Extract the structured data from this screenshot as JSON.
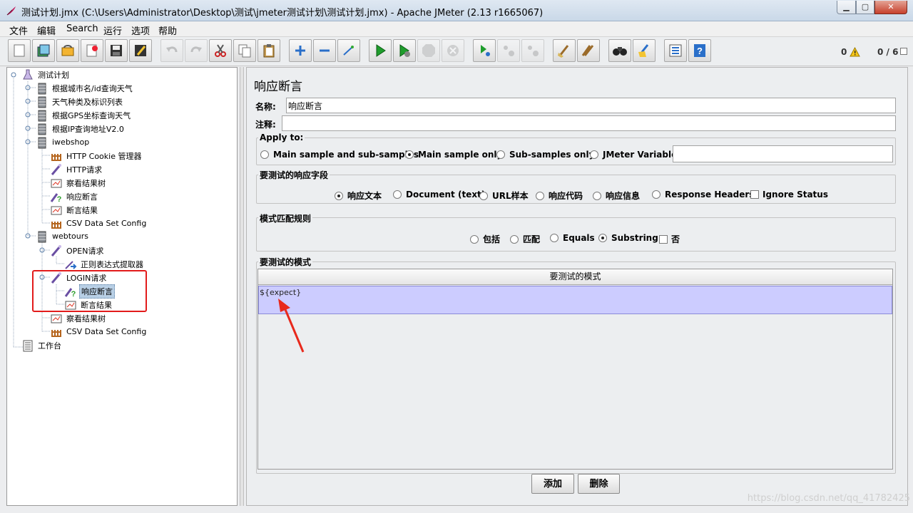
{
  "window": {
    "title": "测试计划.jmx (C:\\Users\\Administrator\\Desktop\\测试\\jmeter测试计划\\测试计划.jmx) - Apache JMeter (2.13 r1665067)",
    "min_glyph": "▁",
    "max_glyph": "▢",
    "close_glyph": "✕"
  },
  "menu": {
    "items": [
      "文件",
      "编辑",
      "Search",
      "运行",
      "选项",
      "帮助"
    ]
  },
  "toolbar": {
    "error_count": "0",
    "thread_status": "0 / 6"
  },
  "tree": {
    "nodes": [
      {
        "label": "测试计划",
        "icon": "test-plan-icon"
      },
      {
        "label": "根据城市名/id查询天气",
        "icon": "thread-group-icon"
      },
      {
        "label": "天气种类及标识列表",
        "icon": "thread-group-icon"
      },
      {
        "label": "根据GPS坐标查询天气",
        "icon": "thread-group-icon"
      },
      {
        "label": "根据IP查询地址V2.0",
        "icon": "thread-group-icon"
      },
      {
        "label": "iwebshop",
        "icon": "thread-group-icon"
      },
      {
        "label": "HTTP Cookie 管理器",
        "icon": "config-icon"
      },
      {
        "label": "HTTP请求",
        "icon": "sampler-icon"
      },
      {
        "label": "察看结果树",
        "icon": "listener-icon"
      },
      {
        "label": "响应断言",
        "icon": "assertion-icon"
      },
      {
        "label": "断言结果",
        "icon": "listener-icon"
      },
      {
        "label": "CSV Data Set Config",
        "icon": "config-icon"
      },
      {
        "label": "webtours",
        "icon": "thread-group-icon"
      },
      {
        "label": "OPEN请求",
        "icon": "sampler-icon"
      },
      {
        "label": "正则表达式提取器",
        "icon": "extractor-icon"
      },
      {
        "label": "LOGIN请求",
        "icon": "sampler-icon"
      },
      {
        "label": "响应断言",
        "icon": "assertion-icon"
      },
      {
        "label": "断言结果",
        "icon": "listener-icon"
      },
      {
        "label": "察看结果树",
        "icon": "listener-icon"
      },
      {
        "label": "CSV Data Set Config",
        "icon": "config-icon"
      },
      {
        "label": "工作台",
        "icon": "workbench-icon"
      }
    ]
  },
  "panel": {
    "title": "响应断言",
    "name_label": "名称:",
    "name_value": "响应断言",
    "comment_label": "注释:",
    "comment_value": "",
    "apply_to": {
      "title": "Apply to:",
      "options": [
        "Main sample and sub-samples",
        "Main sample only",
        "Sub-samples only",
        "JMeter Variable"
      ],
      "selected": "Main sample only",
      "variable_value": ""
    },
    "response_field": {
      "title": "要测试的响应字段",
      "options": [
        "响应文本",
        "Document (text)",
        "URL样本",
        "响应代码",
        "响应信息",
        "Response Headers"
      ],
      "selected": "响应文本",
      "ignore_status_label": "Ignore Status",
      "ignore_status_checked": false
    },
    "match_rules": {
      "title": "模式匹配规则",
      "options": [
        "包括",
        "匹配",
        "Equals",
        "Substring"
      ],
      "selected": "Substring",
      "not_label": "否",
      "not_checked": false
    },
    "patterns": {
      "title": "要测试的模式",
      "column_header": "要测试的模式",
      "rows": [
        "${expect}"
      ]
    },
    "add_button": "添加",
    "delete_button": "删除"
  },
  "watermark": "https://blog.csdn.net/qq_41782425",
  "colors": {
    "selected_row": "#ccccff",
    "highlight_box": "#e21b1b",
    "annotation_arrow": "#e8291c"
  }
}
